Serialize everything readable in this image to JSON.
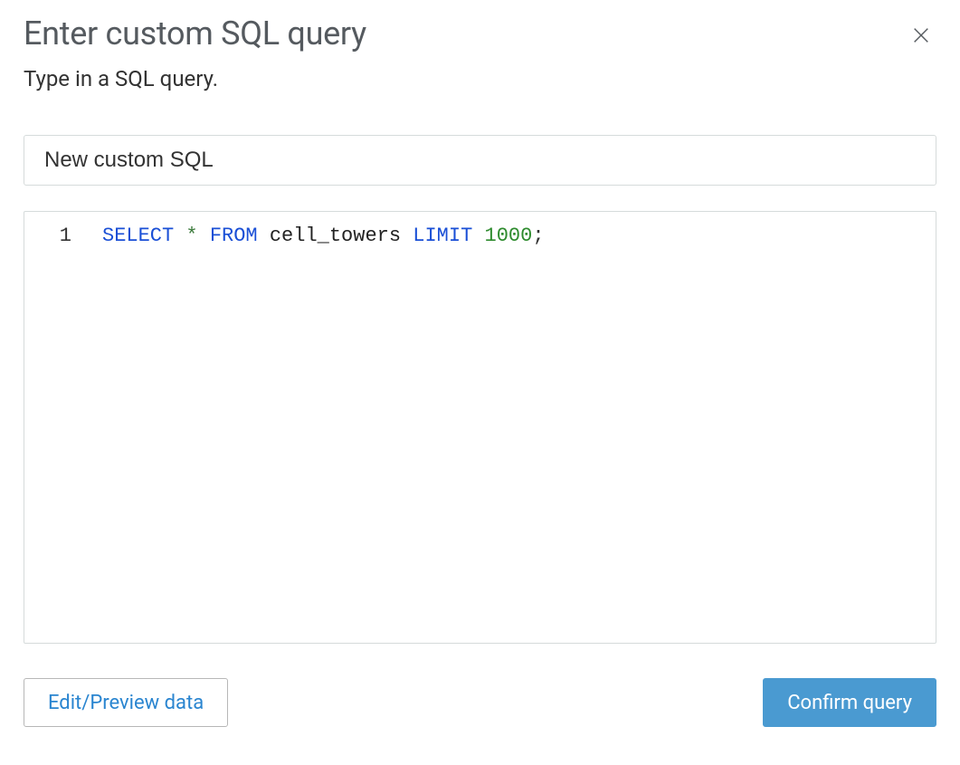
{
  "dialog": {
    "title": "Enter custom SQL query",
    "subtitle": "Type in a SQL query.",
    "name_input_value": "New custom SQL",
    "name_input_placeholder": "New custom SQL"
  },
  "editor": {
    "line_number": "1",
    "tokens": {
      "select": "SELECT",
      "star": "*",
      "from": "FROM",
      "table": "cell_towers",
      "limit": "LIMIT",
      "count": "1000",
      "semi": ";"
    }
  },
  "buttons": {
    "edit_preview": "Edit/Preview data",
    "confirm": "Confirm query"
  }
}
